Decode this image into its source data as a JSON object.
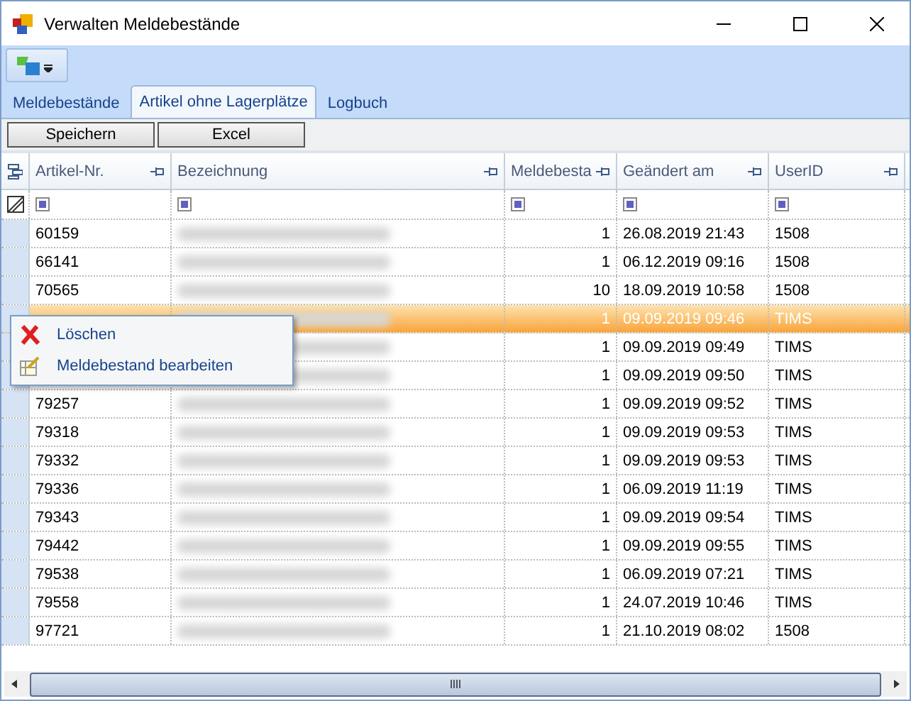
{
  "window": {
    "title": "Verwalten Meldebestände"
  },
  "tabs": [
    {
      "label": "Meldebestände",
      "selected": false
    },
    {
      "label": "Artikel ohne Lagerplätze",
      "selected": true
    },
    {
      "label": "Logbuch",
      "selected": false
    }
  ],
  "buttons": [
    "Speichern",
    "Excel"
  ],
  "table": {
    "columns": [
      "Artikel-Nr.",
      "Bezeichnung",
      "Meldebesta",
      "Geändert am",
      "UserID"
    ],
    "rows": [
      {
        "artikel": "60159",
        "menge": "1",
        "datum": "26.08.2019 21:43",
        "user": "1508",
        "selected": false
      },
      {
        "artikel": "66141",
        "menge": "1",
        "datum": "06.12.2019 09:16",
        "user": "1508",
        "selected": false
      },
      {
        "artikel": "70565",
        "menge": "10",
        "datum": "18.09.2019 10:58",
        "user": "1508",
        "selected": false
      },
      {
        "menge": "1",
        "datum": "09.09.2019 09:46",
        "user": "TIMS",
        "selected": true
      },
      {
        "menge": "1",
        "datum": "09.09.2019 09:49",
        "user": "TIMS",
        "selected": false
      },
      {
        "menge": "1",
        "datum": "09.09.2019 09:50",
        "user": "TIMS",
        "selected": false
      },
      {
        "artikel": "79257",
        "menge": "1",
        "datum": "09.09.2019 09:52",
        "user": "TIMS",
        "selected": false
      },
      {
        "artikel": "79318",
        "menge": "1",
        "datum": "09.09.2019 09:53",
        "user": "TIMS",
        "selected": false
      },
      {
        "artikel": "79332",
        "menge": "1",
        "datum": "09.09.2019 09:53",
        "user": "TIMS",
        "selected": false
      },
      {
        "artikel": "79336",
        "menge": "1",
        "datum": "06.09.2019 11:19",
        "user": "TIMS",
        "selected": false
      },
      {
        "artikel": "79343",
        "menge": "1",
        "datum": "09.09.2019 09:54",
        "user": "TIMS",
        "selected": false
      },
      {
        "artikel": "79442",
        "menge": "1",
        "datum": "09.09.2019 09:55",
        "user": "TIMS",
        "selected": false
      },
      {
        "artikel": "79538",
        "menge": "1",
        "datum": "06.09.2019 07:21",
        "user": "TIMS",
        "selected": false
      },
      {
        "artikel": "79558",
        "menge": "1",
        "datum": "24.07.2019 10:46",
        "user": "TIMS",
        "selected": false
      },
      {
        "artikel": "97721",
        "menge": "1",
        "datum": "21.10.2019 08:02",
        "user": "1508",
        "selected": false
      }
    ]
  },
  "context_menu": [
    {
      "label": "Löschen",
      "kind": "delete"
    },
    {
      "label": "Meldebestand bearbeiten",
      "kind": "edit"
    }
  ]
}
